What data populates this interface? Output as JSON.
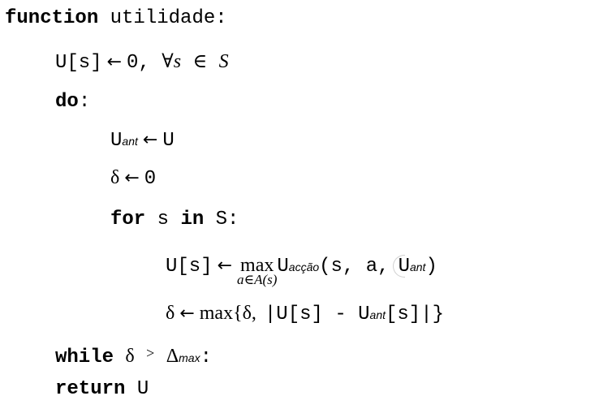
{
  "line1": {
    "kw": "function",
    "name": "utilidade:"
  },
  "line2": {
    "u": "U[s]",
    "arrow": "←",
    "zero": "0,",
    "forall": "∀",
    "s": "s",
    "in": "∈",
    "S": "S"
  },
  "line3": {
    "kw": "do",
    "colon": ":"
  },
  "line4": {
    "u": "U",
    "sub": "ant",
    "arrow": "←",
    "rhs": "U"
  },
  "line5": {
    "delta": "δ",
    "arrow": "←",
    "rhs": "0"
  },
  "line6": {
    "for": "for",
    "s": "s",
    "in": "in",
    "S": "S:"
  },
  "line7": {
    "u": "U[s]",
    "arrow": "←",
    "max": "max",
    "under": "a∈A(s)",
    "ua": "U",
    "sub": "acção",
    "args": "(s,  a,",
    "uant": "U",
    "uant_sub": "ant",
    "close": ")"
  },
  "line8": {
    "delta": "δ",
    "arrow": "←",
    "max": "max{δ,",
    "mid": "|U[s]  -  U",
    "sub": "ant",
    "end": "[s]|}"
  },
  "line9": {
    "while": "while",
    "delta": "δ",
    "gt": ">",
    "Delta": "Δ",
    "sub": "max",
    "colon": ":"
  },
  "line10": {
    "kw": "return",
    "rhs": "U"
  }
}
